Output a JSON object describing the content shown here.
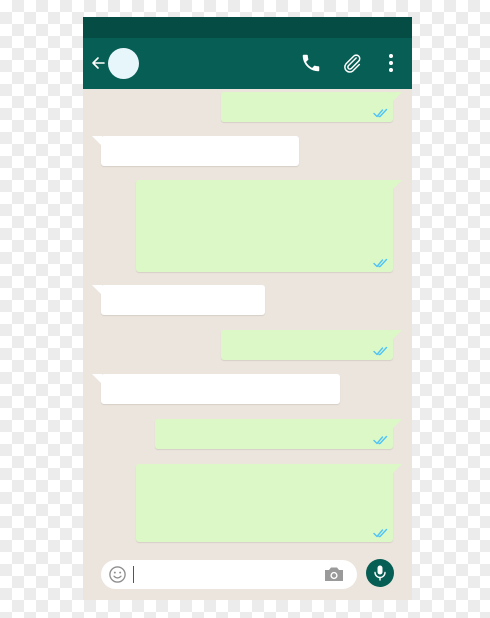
{
  "colors": {
    "status_bar": "#054d44",
    "app_bar": "#075e54",
    "chat_background": "#ece5dd",
    "incoming_bubble": "#ffffff",
    "outgoing_bubble": "#dcf8c6",
    "read_tick": "#4fc3f7",
    "icon_white": "#ffffff",
    "mic_button": "#075e54"
  },
  "header": {
    "contact_name": "",
    "icons": [
      "back-arrow-icon",
      "avatar",
      "phone-icon",
      "paperclip-icon",
      "more-vert-icon"
    ]
  },
  "messages": [
    {
      "direction": "outgoing",
      "text": "",
      "status": "read"
    },
    {
      "direction": "incoming",
      "text": ""
    },
    {
      "direction": "outgoing",
      "text": "",
      "status": "read"
    },
    {
      "direction": "incoming",
      "text": ""
    },
    {
      "direction": "outgoing",
      "text": "",
      "status": "read"
    },
    {
      "direction": "incoming",
      "text": ""
    },
    {
      "direction": "outgoing",
      "text": "",
      "status": "read"
    },
    {
      "direction": "outgoing",
      "text": "",
      "status": "read"
    }
  ],
  "composer": {
    "value": "",
    "placeholder": "",
    "icons": [
      "emoji-icon",
      "camera-icon",
      "microphone-icon"
    ]
  }
}
